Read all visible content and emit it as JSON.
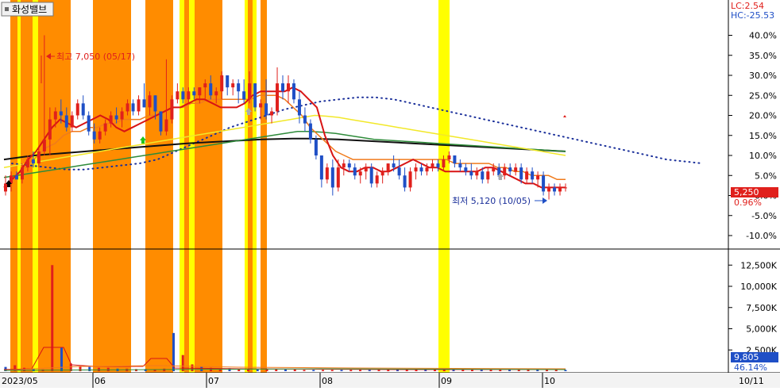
{
  "stock": {
    "name": "화성밸브"
  },
  "header": {
    "lc": "LC:2.54",
    "hc": "HC:-25.53"
  },
  "price_axis_labels": [
    "40.0%",
    "35.0%",
    "30.0%",
    "25.0%",
    "20.0%",
    "15.0%",
    "10.0%",
    "5.0%",
    "0.0%",
    "-5.0%",
    "-10.0%"
  ],
  "volume_axis_labels": [
    "12,500K",
    "10,000K",
    "7,500K",
    "5,000K",
    "2,500K"
  ],
  "current": {
    "price": "5,250",
    "change": "0.96%",
    "volume": "9,805",
    "volume_change": "46.14%"
  },
  "annotations": {
    "high": "최고 7,050 (05/17)",
    "low": "최저 5,120 (10/05)"
  },
  "x_axis_labels": [
    "2023/05",
    "06",
    "07",
    "08",
    "09",
    "10",
    "10/11"
  ],
  "colors": {
    "up": "#e0201c",
    "down": "#1f4fc6",
    "orange_band": "#ff8c00",
    "yellow_band": "#ffff00",
    "ma_red": "#d81414",
    "ma_orange": "#f07b1c",
    "ma_yellow": "#f2e829",
    "ma_green": "#2e8b3a",
    "ma_black": "#111111",
    "ma_dotted": "#1a2f9a"
  },
  "chart_data": {
    "type": "candlestick",
    "y_unit": "% change",
    "ylim": [
      -13,
      45
    ],
    "volume_ylim": [
      0,
      14000
    ],
    "months": [
      "2023/05",
      "06",
      "07",
      "08",
      "09",
      "10"
    ],
    "series": [
      {
        "name": "candles_pct",
        "values": [
          [
            1,
            5,
            0,
            3
          ],
          [
            3,
            6,
            1,
            5
          ],
          [
            5,
            6,
            4,
            4
          ],
          [
            4,
            8,
            3,
            7
          ],
          [
            7,
            10,
            6,
            9
          ],
          [
            9,
            11,
            7,
            8
          ],
          [
            8,
            12,
            7,
            11
          ],
          [
            11,
            40,
            10,
            14
          ],
          [
            14,
            22,
            10,
            19
          ],
          [
            19,
            22,
            17,
            21
          ],
          [
            21,
            24,
            18,
            20
          ],
          [
            20,
            22,
            16,
            17
          ],
          [
            17,
            21,
            16,
            20
          ],
          [
            20,
            24,
            19,
            23
          ],
          [
            23,
            25,
            19,
            20
          ],
          [
            20,
            21,
            15,
            16
          ],
          [
            16,
            18,
            13,
            14
          ],
          [
            14,
            17,
            13,
            16
          ],
          [
            16,
            19,
            15,
            18
          ],
          [
            18,
            21,
            17,
            20
          ],
          [
            20,
            22,
            18,
            19
          ],
          [
            19,
            22,
            17,
            21
          ],
          [
            21,
            24,
            20,
            23
          ],
          [
            23,
            24,
            20,
            21
          ],
          [
            21,
            25,
            20,
            24
          ],
          [
            24,
            28,
            22,
            22
          ],
          [
            22,
            26,
            20,
            25
          ],
          [
            25,
            25,
            19,
            21
          ],
          [
            21,
            21,
            15,
            16
          ],
          [
            16,
            34,
            15,
            19
          ],
          [
            19,
            25,
            18,
            24
          ],
          [
            24,
            28,
            23,
            26
          ],
          [
            26,
            27,
            23,
            24
          ],
          [
            24,
            27,
            23,
            26
          ],
          [
            26,
            27,
            24,
            25
          ],
          [
            25,
            27,
            23,
            27
          ],
          [
            27,
            29,
            24,
            28
          ],
          [
            28,
            30,
            24,
            25
          ],
          [
            25,
            27,
            23,
            26
          ],
          [
            26,
            31,
            24,
            30
          ],
          [
            30,
            30,
            25,
            27
          ],
          [
            27,
            29,
            25,
            28
          ],
          [
            28,
            29,
            23,
            26
          ],
          [
            26,
            29,
            23,
            24
          ],
          [
            24,
            31,
            23,
            28
          ],
          [
            28,
            28,
            21,
            22
          ],
          [
            22,
            24,
            19,
            23
          ],
          [
            23,
            29,
            19,
            20
          ],
          [
            20,
            22,
            18,
            21
          ],
          [
            21,
            32,
            20,
            28
          ],
          [
            28,
            30,
            24,
            26
          ],
          [
            26,
            30,
            23,
            28
          ],
          [
            28,
            29,
            23,
            24
          ],
          [
            24,
            26,
            18,
            20
          ],
          [
            20,
            22,
            16,
            18
          ],
          [
            18,
            19,
            13,
            14
          ],
          [
            14,
            15,
            9,
            10
          ],
          [
            10,
            10,
            2,
            4
          ],
          [
            4,
            8,
            3,
            7
          ],
          [
            7,
            9,
            0,
            2
          ],
          [
            2,
            9,
            1,
            7
          ],
          [
            7,
            9,
            5,
            8
          ],
          [
            8,
            9,
            6,
            7
          ],
          [
            7,
            8,
            4,
            5
          ],
          [
            5,
            7,
            3,
            6
          ],
          [
            6,
            8,
            4,
            7
          ],
          [
            7,
            8,
            2,
            3
          ],
          [
            3,
            6,
            2,
            5
          ],
          [
            5,
            7,
            3,
            6
          ],
          [
            6,
            8,
            5,
            8
          ],
          [
            8,
            10,
            6,
            7
          ],
          [
            7,
            9,
            4,
            5
          ],
          [
            5,
            7,
            1,
            2
          ],
          [
            2,
            7,
            1,
            6
          ],
          [
            6,
            8,
            4,
            7
          ],
          [
            7,
            8,
            5,
            6
          ],
          [
            6,
            8,
            5,
            7
          ],
          [
            7,
            9,
            6,
            8
          ],
          [
            8,
            9,
            6,
            7
          ],
          [
            7,
            10,
            6,
            9
          ],
          [
            9,
            11,
            8,
            10
          ],
          [
            10,
            10,
            7,
            8
          ],
          [
            8,
            9,
            6,
            7
          ],
          [
            7,
            8,
            5,
            6
          ],
          [
            6,
            8,
            4,
            5
          ],
          [
            5,
            7,
            4,
            6
          ],
          [
            6,
            7,
            3,
            4
          ],
          [
            4,
            7,
            3,
            6
          ],
          [
            6,
            8,
            5,
            7
          ],
          [
            7,
            8,
            4,
            5
          ],
          [
            5,
            8,
            4,
            7
          ],
          [
            7,
            8,
            5,
            6
          ],
          [
            6,
            8,
            5,
            7
          ],
          [
            7,
            8,
            3,
            4
          ],
          [
            4,
            7,
            3,
            6
          ],
          [
            6,
            7,
            3,
            4
          ],
          [
            4,
            6,
            2,
            5
          ],
          [
            5,
            6,
            0,
            1
          ],
          [
            1,
            3,
            -1,
            2
          ],
          [
            2,
            3,
            0,
            1
          ],
          [
            1,
            3,
            0,
            2
          ],
          [
            2,
            3,
            1,
            2
          ]
        ]
      },
      {
        "name": "ma_red",
        "values": [
          2,
          4,
          6,
          9,
          11,
          14,
          17,
          19,
          18,
          17,
          18,
          19,
          20,
          19,
          17,
          16,
          17,
          18,
          19,
          20,
          21,
          22,
          22,
          23,
          24,
          24,
          23,
          22,
          22,
          22,
          23,
          25,
          26,
          26,
          26,
          26,
          27,
          26,
          24,
          22,
          15,
          10,
          7,
          6,
          6,
          7,
          7,
          6,
          6,
          7,
          8,
          9,
          8,
          7,
          7,
          6,
          6,
          6,
          6,
          6,
          7,
          7,
          6,
          5,
          4,
          3,
          3,
          2,
          2,
          2,
          2
        ]
      },
      {
        "name": "ma_orange",
        "values": [
          2,
          4,
          6,
          8,
          10,
          12,
          13,
          15,
          16,
          16,
          17,
          17,
          18,
          18,
          19,
          19,
          19,
          20,
          20,
          21,
          22,
          22,
          23,
          23,
          24,
          24,
          24,
          24,
          24,
          24,
          25,
          25,
          25,
          24,
          22,
          20,
          17,
          15,
          13,
          11,
          10,
          9,
          9,
          9,
          9,
          9,
          9,
          9,
          9,
          9,
          9,
          9,
          9,
          8,
          8,
          8,
          8,
          8,
          7,
          7,
          6,
          6,
          5,
          5,
          5,
          4,
          4
        ]
      },
      {
        "name": "ma_yellow",
        "values": [
          7,
          7.5,
          8,
          8.5,
          9,
          9.5,
          10,
          10.5,
          11,
          11.5,
          12,
          12.5,
          13,
          13.5,
          14,
          14.5,
          15,
          15.5,
          16,
          16.5,
          17,
          17.5,
          18,
          18.5,
          19,
          19.5,
          20,
          19.8,
          19.5,
          19,
          18.5,
          18,
          17.5,
          17,
          16.5,
          16,
          15.5,
          15,
          14.5,
          14,
          13.5,
          13,
          12.5,
          12,
          11.5,
          11,
          10.5,
          10
        ]
      },
      {
        "name": "ma_green",
        "values": [
          4.5,
          5,
          5.5,
          6,
          6.5,
          7,
          7.5,
          8,
          8.5,
          9,
          9.5,
          10,
          10.5,
          11,
          11.5,
          12,
          12.5,
          13,
          13.5,
          14,
          14.5,
          15,
          15.5,
          16,
          16,
          15.8,
          15.5,
          15,
          14.5,
          14,
          13.8,
          13.6,
          13.4,
          13.2,
          13,
          12.8,
          12.6,
          12.4,
          12.2,
          12,
          11.8,
          11.6,
          11.4,
          11.2,
          11
        ]
      },
      {
        "name": "ma_black",
        "values": [
          9,
          9.5,
          10,
          10.3,
          10.6,
          10.9,
          11.2,
          11.5,
          11.8,
          12.1,
          12.4,
          12.7,
          13,
          13.2,
          13.4,
          13.6,
          13.8,
          14,
          14.1,
          14.2,
          14.2,
          14.1,
          14,
          13.8,
          13.6,
          13.4,
          13.2,
          13,
          12.8,
          12.6,
          12.4,
          12.2,
          12,
          11.8,
          11.6,
          11.4,
          11.2,
          11
        ]
      },
      {
        "name": "ma_dotted",
        "values": [
          8,
          7.5,
          7,
          6.5,
          6.5,
          7,
          7.5,
          8,
          9,
          11,
          13,
          15,
          17,
          18.5,
          20,
          21.5,
          22.5,
          23.5,
          24,
          24.5,
          24.5,
          24,
          23,
          22,
          21,
          20,
          19,
          18,
          17,
          16,
          15,
          14,
          13,
          12,
          11,
          10,
          9,
          8.5,
          8
        ]
      },
      {
        "name": "volume_K",
        "values": [
          500,
          700,
          400,
          300,
          200,
          12500,
          2800,
          900,
          600,
          500,
          400,
          400,
          300,
          300,
          250,
          250,
          200,
          300,
          4500,
          1900,
          800,
          500,
          400,
          300,
          350,
          300,
          200,
          200,
          300,
          250,
          200,
          200,
          150,
          150,
          150,
          150,
          150,
          150,
          150,
          150,
          150,
          150,
          150,
          150,
          150,
          150,
          150,
          150,
          150,
          150,
          150,
          150,
          150,
          150,
          150,
          150,
          150,
          150,
          150,
          150,
          150
        ]
      }
    ]
  }
}
